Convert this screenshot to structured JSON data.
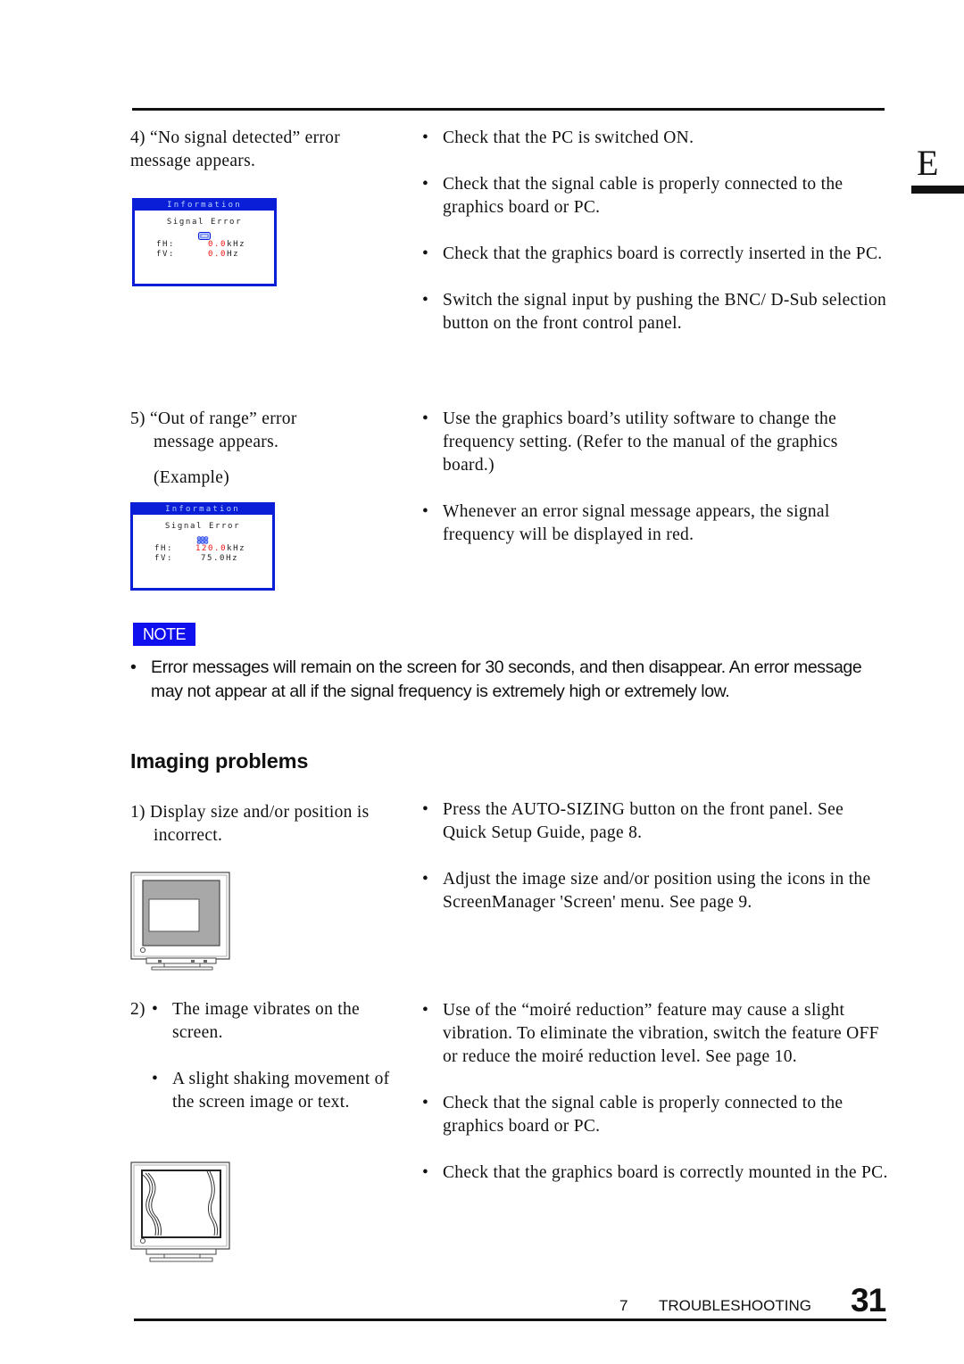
{
  "side_tab": {
    "letter": "E"
  },
  "problems": [
    {
      "label": "4) “No signal detected” error message appears.",
      "osd": {
        "title": "Information",
        "heading": "Signal Error",
        "icon": "d-sub-connector-icon",
        "rows": [
          {
            "key": "fH:",
            "value": "0.0",
            "unit": "kHz",
            "value_color": "#f01010"
          },
          {
            "key": "fV:",
            "value": "0.0",
            "unit": "Hz",
            "value_color": "#f01010"
          }
        ]
      },
      "solutions": [
        "Check that the PC is switched ON.",
        "Check that the signal cable is properly connected to the graphics board or PC.",
        "Check that the graphics board is correctly inserted in the PC.",
        "Switch the signal input by pushing the BNC/ D-Sub selection button on the front control panel."
      ]
    },
    {
      "label": "5) “Out of range” error message appears.",
      "example_label": "(Example)",
      "osd": {
        "title": "Information",
        "heading": "Signal Error",
        "icon": "bnc-connector-icon",
        "rows": [
          {
            "key": "fH:",
            "value": "120.0",
            "unit": "kHz",
            "value_color": "#f01010"
          },
          {
            "key": "fV:",
            "value": "75.0",
            "unit": "Hz",
            "value_color": "#222222"
          }
        ]
      },
      "solutions": [
        "Use the graphics board’s utility software to change the frequency setting.  (Refer to the manual of the graphics board.)",
        "Whenever an error signal message appears, the signal frequency will be displayed in red."
      ]
    }
  ],
  "note": {
    "badge": "NOTE",
    "text": "Error messages will remain on the screen for 30 seconds, and then disappear.  An error message may not appear at all if the signal frequency is extremely high or extremely low."
  },
  "section": {
    "title": "Imaging problems"
  },
  "imaging": [
    {
      "label": "1) Display size and/or position is incorrect.",
      "illustration": "monitor-small-image-icon",
      "solutions": [
        "Press the AUTO-SIZING button on the front panel. See Quick Setup Guide, page 8.",
        "Adjust the image size and/or position using the icons in the ScreenManager 'Screen' menu.  See page 9."
      ]
    },
    {
      "number": "2)",
      "symptoms": [
        "The image vibrates on the screen.",
        "A slight shaking movement of the screen image or text."
      ],
      "illustration": "monitor-vibrating-image-icon",
      "solutions": [
        "Use of the “moiré reduction” feature may cause a slight vibration.  To eliminate the vibration, switch the feature OFF or reduce the moiré reduction level. See page 10.",
        "Check that the signal cable is properly connected to the graphics board or PC.",
        "Check that the graphics board is correctly mounted in the PC."
      ]
    }
  ],
  "footer": {
    "chapter_number": "7",
    "chapter_title": "TROUBLESHOOTING",
    "page_number": "31"
  },
  "colors": {
    "osd_blue": "#0a1ed8",
    "error_red": "#f01010",
    "note_blue": "#1010ee"
  }
}
